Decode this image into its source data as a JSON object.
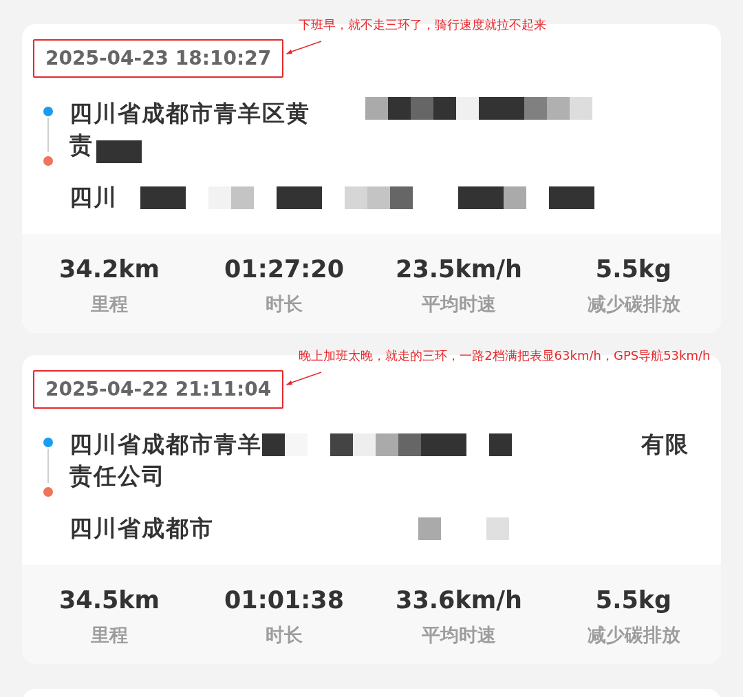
{
  "records": [
    {
      "annotation": {
        "note": "下班早，就不走三环了，骑行速度就拉不起来"
      },
      "time": "2025-04-23 18:10:27",
      "start_lines": [
        {
          "segments": [
            {
              "kind": "text",
              "text": "四川省成都市青羊区黄"
            },
            {
              "kind": "mosaic"
            }
          ]
        },
        {
          "segments": [
            {
              "kind": "text",
              "text": "责"
            },
            {
              "kind": "mosaic"
            }
          ]
        }
      ],
      "end_lines": [
        {
          "segments": [
            {
              "kind": "text",
              "text": "四川"
            },
            {
              "kind": "mosaic"
            }
          ]
        }
      ],
      "stats": [
        {
          "value": "34.2km",
          "label": "里程"
        },
        {
          "value": "01:27:20",
          "label": "时长"
        },
        {
          "value": "23.5km/h",
          "label": "平均时速"
        },
        {
          "value": "5.5kg",
          "label": "减少碳排放"
        }
      ]
    },
    {
      "annotation": {
        "note": "晚上加班太晚，就走的三环，一路2档满把表显63km/h，GPS导航53km/h"
      },
      "time": "2025-04-22 21:11:04",
      "start_lines": [
        {
          "segments": [
            {
              "kind": "text",
              "text": "四川省成都市青羊"
            },
            {
              "kind": "mosaic"
            },
            {
              "kind": "text",
              "text": "有限"
            }
          ]
        },
        {
          "segments": [
            {
              "kind": "text",
              "text": "责任公司"
            }
          ]
        }
      ],
      "end_lines": [
        {
          "segments": [
            {
              "kind": "text",
              "text": "四川省成都市"
            },
            {
              "kind": "mosaic"
            }
          ]
        }
      ],
      "stats": [
        {
          "value": "34.5km",
          "label": "里程"
        },
        {
          "value": "01:01:38",
          "label": "时长"
        },
        {
          "value": "33.6km/h",
          "label": "平均时速"
        },
        {
          "value": "5.5kg",
          "label": "减少碳排放"
        }
      ]
    }
  ]
}
